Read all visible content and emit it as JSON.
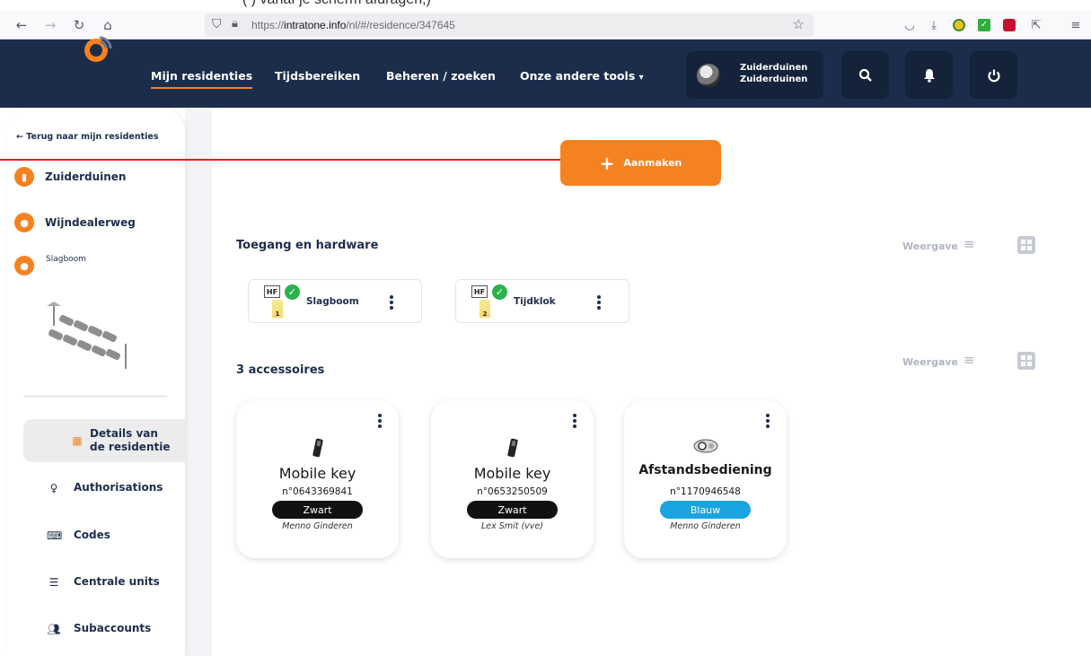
{
  "clipped_caption": "(                ) vanaf je scherm afdragen,)",
  "browser": {
    "url_prefix": "https://",
    "url_domain": "intratone.info",
    "url_path": "/nl/#/residence/347645",
    "icons": [
      "back-arrow-icon",
      "forward-arrow-icon",
      "reload-icon",
      "home-icon",
      "shield-icon",
      "lock-icon",
      "star-icon",
      "pocket-icon",
      "download-icon",
      "extension-icons",
      "share-icon",
      "menu-icon"
    ]
  },
  "header": {
    "nav": [
      "Mijn residenties",
      "Tijdsbereiken",
      "Beheren / zoeken",
      "Onze andere tools"
    ],
    "dropdown_caret": "▾",
    "user_line1": "Zuiderduinen",
    "user_line2": "Zuiderduinen",
    "accent": "#f58220",
    "header_color": "#1b2d4b"
  },
  "sidebar": {
    "back": "Terug naar mijn residenties",
    "locations": [
      {
        "label": "Zuiderduinen",
        "icon": "bookmark-icon"
      },
      {
        "label": "Wijndealerweg",
        "icon": "map-pin-icon"
      }
    ],
    "sub_location": "Slagboom",
    "menu": [
      {
        "label": "Details van de residentie",
        "icon": "building-icon",
        "active": true
      },
      {
        "label": "Authorisations",
        "icon": "lightbulb-icon",
        "active": false
      },
      {
        "label": "Codes",
        "icon": "keyboard-icon",
        "active": false
      },
      {
        "label": "Centrale units",
        "icon": "server-icon",
        "active": false
      },
      {
        "label": "Subaccounts",
        "icon": "users-icon",
        "active": false
      }
    ]
  },
  "main": {
    "create_button": "Aanmaken",
    "hardware_title": "Toegang en hardware",
    "view_label": "Weergave",
    "hardware": [
      {
        "name": "Slagboom",
        "badge": "HF",
        "tag": "1"
      },
      {
        "name": "Tijdklok",
        "badge": "HF",
        "tag": "2"
      }
    ],
    "accessories_title": "3 accessoires",
    "accessories": [
      {
        "title": "Mobile key",
        "number": "n°0643369841",
        "color_label": "Zwart",
        "color": "#111111",
        "owner": "Menno Ginderen",
        "icon": "phone-icon"
      },
      {
        "title": "Mobile key",
        "number": "n°0653250509",
        "color_label": "Zwart",
        "color": "#111111",
        "owner": "Lex Smit (vve)",
        "icon": "phone-icon"
      },
      {
        "title": "Afstandsbediening",
        "number": "n°1170946548",
        "color_label": "Blauw",
        "color": "#1aa5e0",
        "owner": "Menno Ginderen",
        "icon": "remote-control-icon"
      }
    ]
  }
}
